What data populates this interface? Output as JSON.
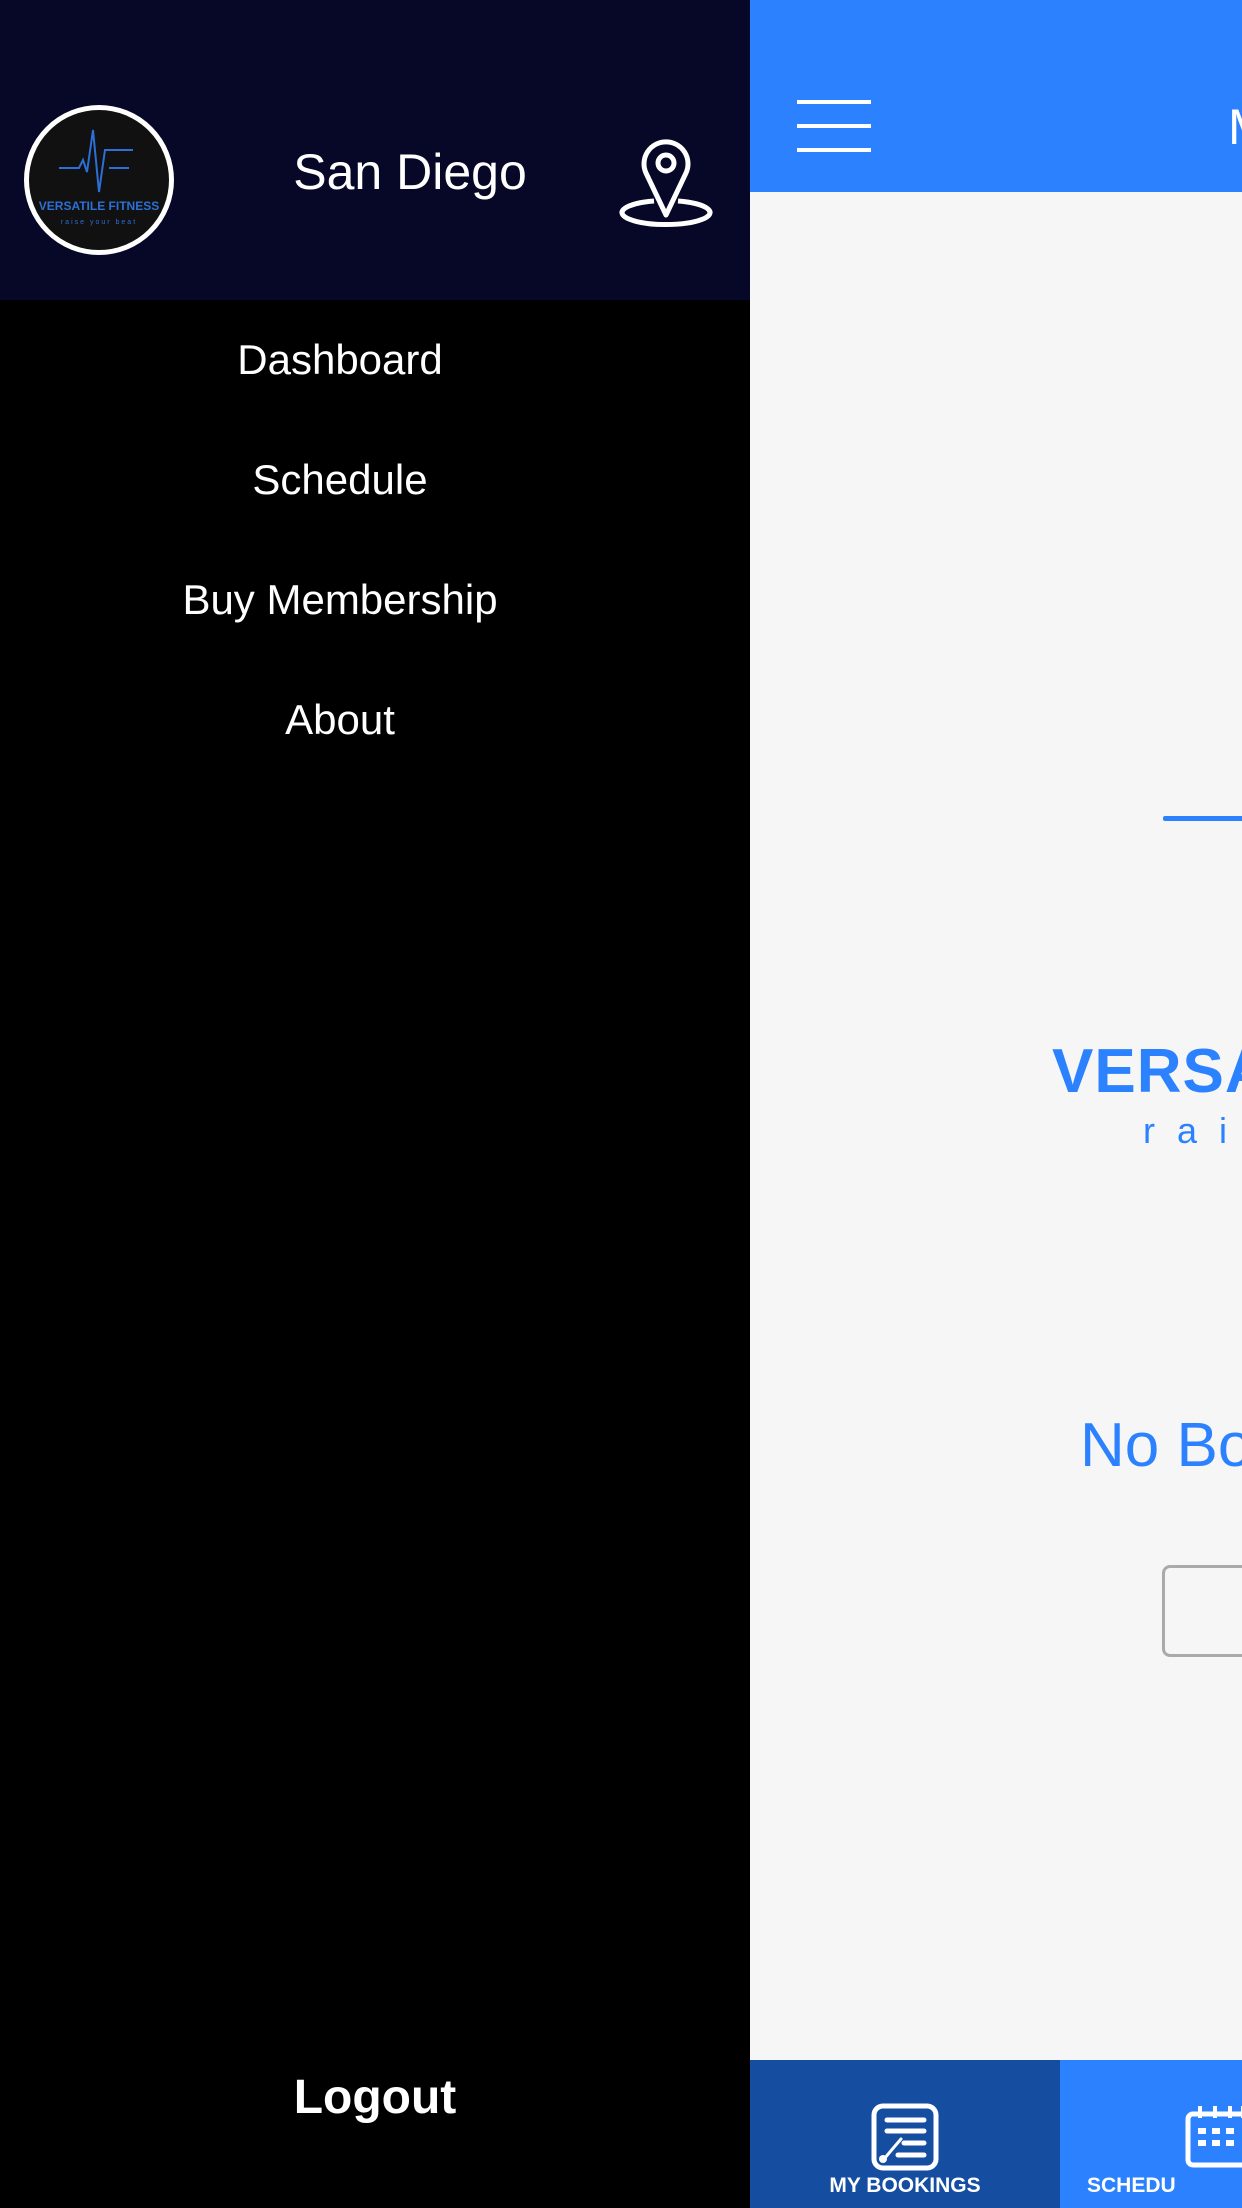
{
  "sidebar": {
    "location": "San Diego",
    "logo_text": "VERSATILE FITNESS",
    "logo_tagline": "raise your beat",
    "items": [
      {
        "label": "Dashboard"
      },
      {
        "label": "Schedule"
      },
      {
        "label": "Buy Membership"
      },
      {
        "label": "About"
      }
    ],
    "logout_label": "Logout"
  },
  "main": {
    "title": "M",
    "brand": "VERSA",
    "tagline": "rais",
    "empty_message": "No Bo",
    "tabs": [
      {
        "label": "MY BOOKINGS",
        "icon": "bookings-list-icon",
        "active": true
      },
      {
        "label": "SCHEDU",
        "icon": "calendar-icon",
        "active": false
      }
    ]
  },
  "colors": {
    "accent": "#2c82fe",
    "active_tab": "#154ea1",
    "sidebar_header": "#070828",
    "sidebar_bg": "#000000"
  }
}
